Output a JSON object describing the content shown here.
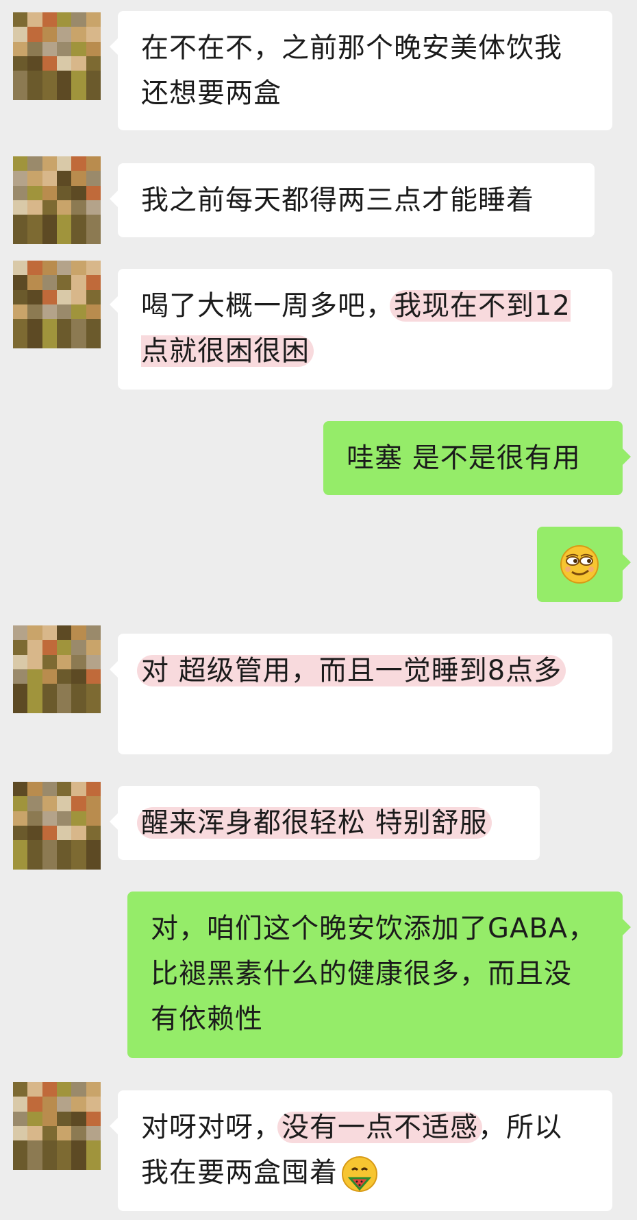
{
  "messages": [
    {
      "side": "in",
      "segments": [
        {
          "text": "在不在不，之前那个晚安美体饮我还想要两盒",
          "hl": false
        }
      ]
    },
    {
      "side": "in",
      "segments": [
        {
          "text": "我之前每天都得两三点才能睡着",
          "hl": false
        }
      ]
    },
    {
      "side": "in",
      "segments": [
        {
          "text": "喝了大概一周多吧，",
          "hl": false
        },
        {
          "text": "我现在不到12点就很困很困",
          "hl": true
        }
      ]
    },
    {
      "side": "out",
      "segments": [
        {
          "text": "哇塞 是不是很有用",
          "hl": false
        }
      ]
    },
    {
      "side": "out",
      "emoji": "smirk-face-icon"
    },
    {
      "side": "in",
      "segments": [
        {
          "text": "对 超级管用，而且一觉睡到8点多",
          "hl": true
        }
      ]
    },
    {
      "side": "in",
      "segments": [
        {
          "text": "醒来浑身都很轻松 特别舒服",
          "hl": true
        }
      ]
    },
    {
      "side": "out",
      "segments": [
        {
          "text": "对，咱们这个晚安饮添加了GABA，比褪黑素什么的健康很多，而且没有依赖性",
          "hl": false
        }
      ]
    },
    {
      "side": "in",
      "segments": [
        {
          "text": "对呀对呀，",
          "hl": false
        },
        {
          "text": "没有一点不适感",
          "hl": true
        },
        {
          "text": "，所以我在要两盒囤着",
          "hl": false
        }
      ],
      "trailing_emoji": "watermelon-face-icon"
    }
  ],
  "colors": {
    "background": "#ededed",
    "incoming_bubble": "#ffffff",
    "outgoing_bubble": "#95ec69",
    "highlight": "#f8dadd"
  }
}
